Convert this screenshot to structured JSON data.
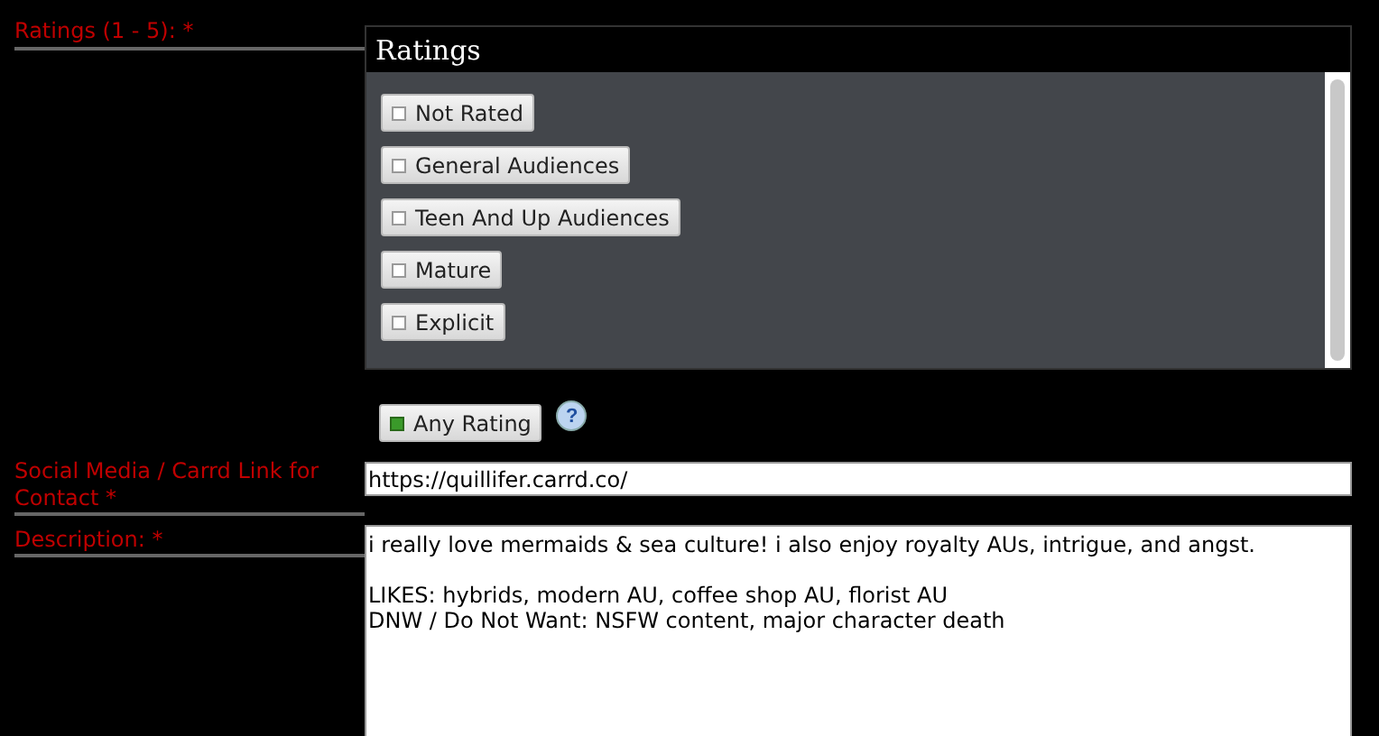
{
  "ratings_label": "Ratings (1 - 5): *",
  "ratings_panel": {
    "title": "Ratings",
    "options": [
      {
        "label": "Not Rated",
        "checked": false
      },
      {
        "label": "General Audiences",
        "checked": false
      },
      {
        "label": "Teen And Up Audiences",
        "checked": false
      },
      {
        "label": "Mature",
        "checked": false
      },
      {
        "label": "Explicit",
        "checked": false
      }
    ]
  },
  "any_rating": {
    "label": "Any Rating",
    "checked": true
  },
  "help": "?",
  "contact": {
    "label": "Social Media / Carrd Link for Contact *",
    "value": "https://quillifer.carrd.co/"
  },
  "description": {
    "label": "Description: *",
    "value": "i really love mermaids & sea culture! i also enjoy royalty AUs, intrigue, and angst.\n\nLIKES: hybrids, modern AU, coffee shop AU, florist AU\nDNW / Do Not Want: NSFW content, major character death"
  }
}
